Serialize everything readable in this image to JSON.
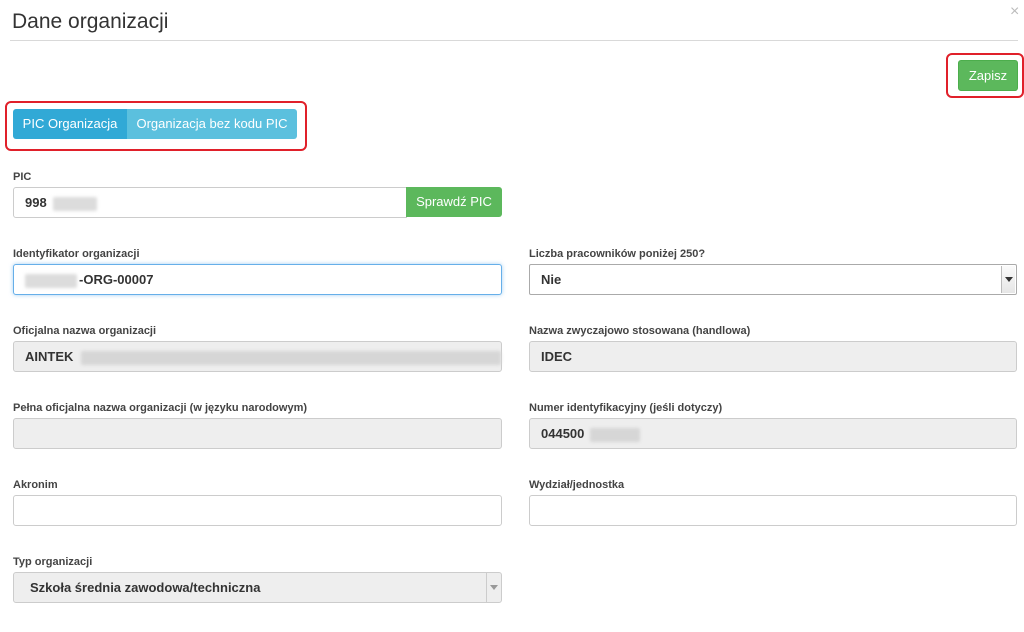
{
  "dialog": {
    "title": "Dane organizacji",
    "close_icon": "close-icon",
    "close_glyph": "×"
  },
  "toolbar": {
    "save_label": "Zapisz"
  },
  "tabs": [
    {
      "label": "PIC Organizacja",
      "active": true
    },
    {
      "label": "Organizacja bez kodu PIC",
      "active": false
    }
  ],
  "form": {
    "pic": {
      "label": "PIC",
      "value": "998",
      "check_button": "Sprawdź PIC"
    },
    "org_id": {
      "label": "Identyfikator organizacji",
      "value": "-ORG-00007"
    },
    "employees": {
      "label": "Liczba pracowników poniżej 250?",
      "value": "Nie"
    },
    "official_name": {
      "label": "Oficjalna nazwa organizacji",
      "value": "AINTEK"
    },
    "common_name": {
      "label": "Nazwa zwyczajowo stosowana (handlowa)",
      "value": "IDEC"
    },
    "full_name": {
      "label": "Pełna oficjalna nazwa organizacji (w języku narodowym)",
      "value": ""
    },
    "id_number": {
      "label": "Numer identyfikacyjny (jeśli dotyczy)",
      "value": "044500"
    },
    "acronym": {
      "label": "Akronim",
      "value": ""
    },
    "department": {
      "label": "Wydział/jednostka",
      "value": ""
    },
    "org_type": {
      "label": "Typ organizacji",
      "value": "Szkoła średnia zawodowa/techniczna"
    }
  },
  "colors": {
    "save_green": "#5cb85c",
    "tab_active": "#31a9d6",
    "tab_inactive": "#5bc0de",
    "highlight_red": "#e0202a"
  }
}
